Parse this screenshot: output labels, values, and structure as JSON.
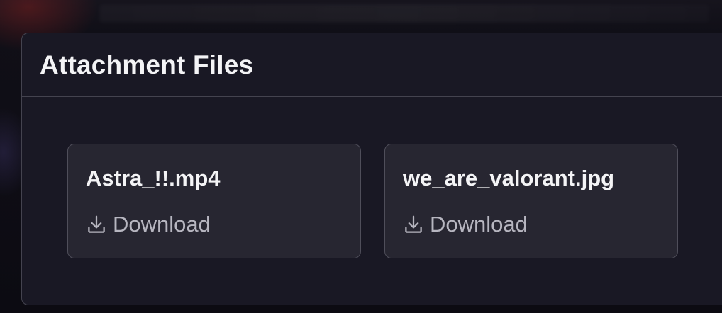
{
  "modal": {
    "title": "Attachment Files"
  },
  "files": [
    {
      "name": "Astra_!!.mp4",
      "action_label": "Download",
      "action_icon": "download-icon"
    },
    {
      "name": "we_are_valorant.jpg",
      "action_label": "Download",
      "action_icon": "download-icon"
    }
  ],
  "colors": {
    "modal_bg": "#191824",
    "card_bg": "#272631",
    "border": "#44434f",
    "title_text": "#f4f4f6",
    "link_text": "#b7b6c0"
  }
}
